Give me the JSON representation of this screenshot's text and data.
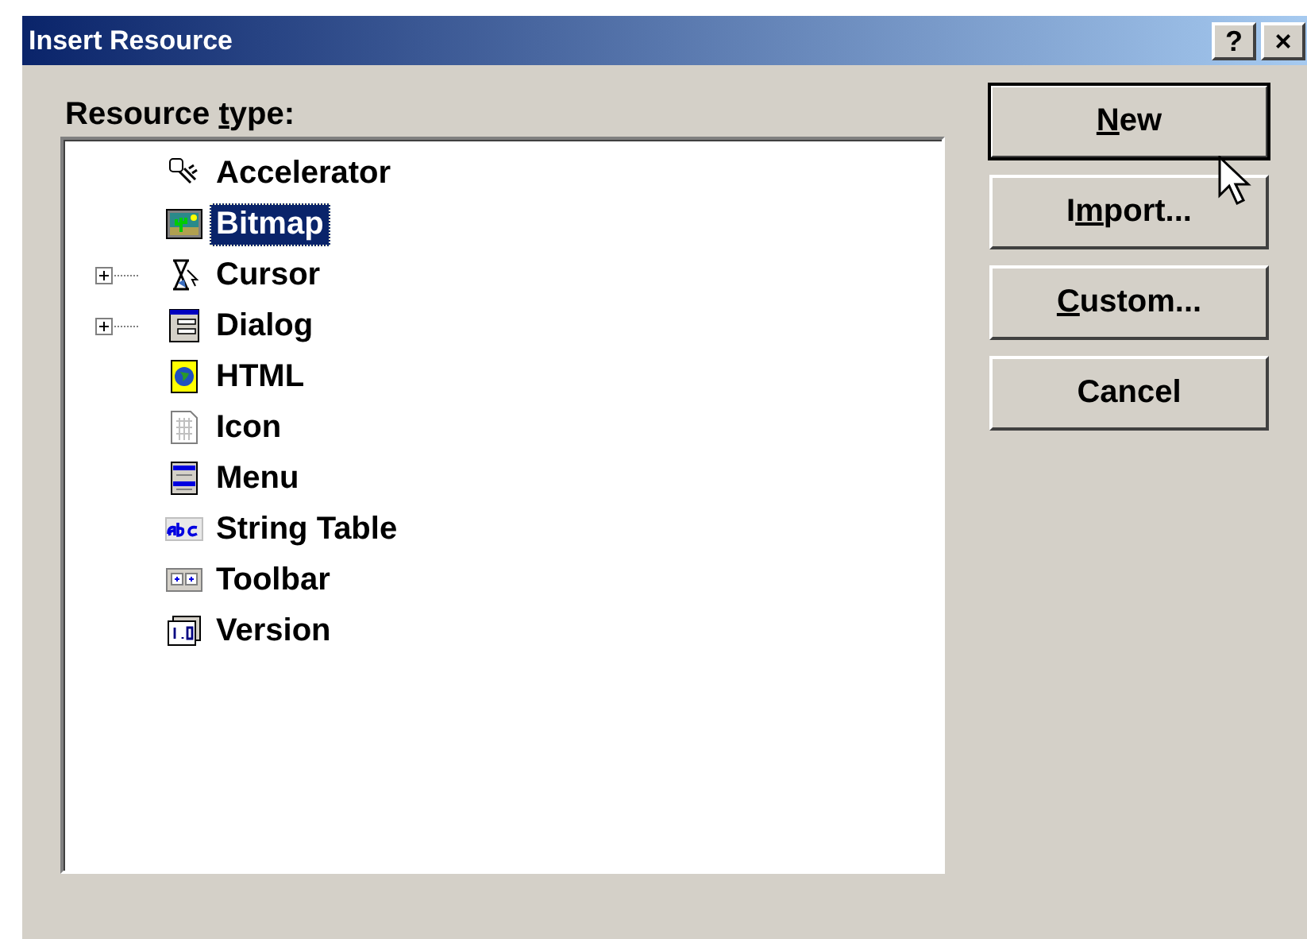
{
  "window": {
    "title": "Insert Resource",
    "title_buttons": [
      "?",
      "×"
    ]
  },
  "resource_type": {
    "label_parts": [
      {
        "text": "Resource "
      },
      {
        "text": "t",
        "underlined": true
      },
      {
        "text": "ype:"
      }
    ]
  },
  "tree": [
    {
      "label": "Accelerator",
      "kind": "accelerator",
      "selected": false
    },
    {
      "label": "Bitmap",
      "kind": "bitmap",
      "selected": true
    },
    {
      "label": "Cursor",
      "kind": "cursor",
      "selected": false,
      "expanded": false
    },
    {
      "label": "Dialog",
      "kind": "dialog",
      "selected": false,
      "expanded": false
    },
    {
      "label": "HTML",
      "kind": "html",
      "selected": false
    },
    {
      "label": "Icon",
      "kind": "icon",
      "selected": false
    },
    {
      "label": "Menu",
      "kind": "menu",
      "selected": false
    },
    {
      "label": "String Table",
      "kind": "string_table",
      "selected": false
    },
    {
      "label": "Toolbar",
      "kind": "toolbar",
      "selected": false
    },
    {
      "label": "Version",
      "kind": "version",
      "selected": false
    }
  ],
  "buttons": [
    {
      "label_parts": [
        {
          "text": "N",
          "underlined": true
        },
        {
          "text": "ew"
        }
      ],
      "default": true
    },
    {
      "label_parts": [
        {
          "text": "I"
        },
        {
          "text": "m",
          "underlined": true
        },
        {
          "text": "port..."
        }
      ],
      "default": false
    },
    {
      "label_parts": [
        {
          "text": "C",
          "underlined": true
        },
        {
          "text": "ustom..."
        }
      ],
      "default": false
    },
    {
      "label_parts": [
        {
          "text": "Cancel"
        }
      ],
      "default": false
    }
  ]
}
